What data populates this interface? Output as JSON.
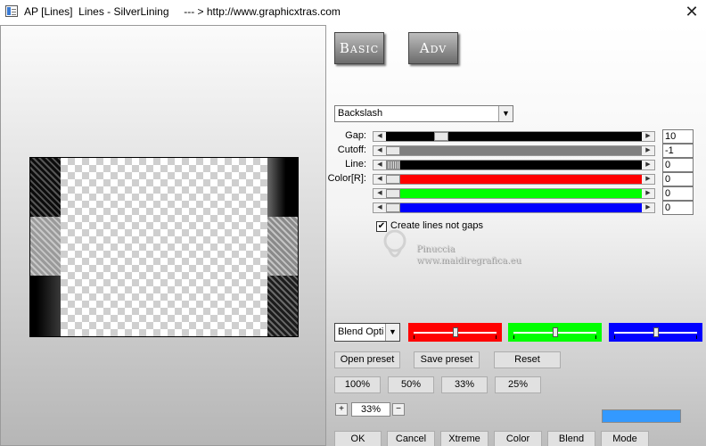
{
  "window": {
    "title": "AP [Lines]  Lines - SilverLining     --- > http://www.graphicxtras.com",
    "close_glyph": "✕"
  },
  "mode_tabs": {
    "basic": "Basic",
    "adv": "Adv"
  },
  "effect_select": {
    "value": "Backslash"
  },
  "sliders": [
    {
      "label": "Gap:",
      "value": "10",
      "thumb_fraction": 0.2,
      "track": "#000000"
    },
    {
      "label": "Cutoff:",
      "value": "-1",
      "thumb_fraction": 0.0,
      "track": "#808080"
    },
    {
      "label": "Line:",
      "value": "0",
      "thumb_fraction": 0.0,
      "track": "#000000"
    },
    {
      "label": "Color[R]:",
      "value": "0",
      "thumb_fraction": 0.0,
      "track": "#ff0000"
    },
    {
      "label": "",
      "value": "0",
      "thumb_fraction": 0.0,
      "track": "#00ff00"
    },
    {
      "label": "",
      "value": "0",
      "thumb_fraction": 0.0,
      "track": "#0000ff"
    }
  ],
  "create_lines": {
    "checked": true,
    "label": "Create lines not gaps",
    "check_glyph": "✔"
  },
  "watermark": {
    "name": "Pinuccia",
    "url": "www.maidiregrafica.eu"
  },
  "blend_options": {
    "value": "Blend Options"
  },
  "channel_sliders": [
    {
      "color": "#ff0000",
      "fraction": 0.5
    },
    {
      "color": "#00ff00",
      "fraction": 0.5
    },
    {
      "color": "#0000ff",
      "fraction": 0.5
    }
  ],
  "preset_buttons": {
    "open": "Open preset",
    "save": "Save preset",
    "reset": "Reset"
  },
  "zoom_buttons": [
    "100%",
    "50%",
    "33%",
    "25%"
  ],
  "zoom_stepper": {
    "plus": "+",
    "minus": "−",
    "value": "33%"
  },
  "accent_color": "#3399ff",
  "bottom_buttons": [
    "OK",
    "Cancel",
    "Xtreme",
    "Color",
    "Blend",
    "Mode"
  ]
}
